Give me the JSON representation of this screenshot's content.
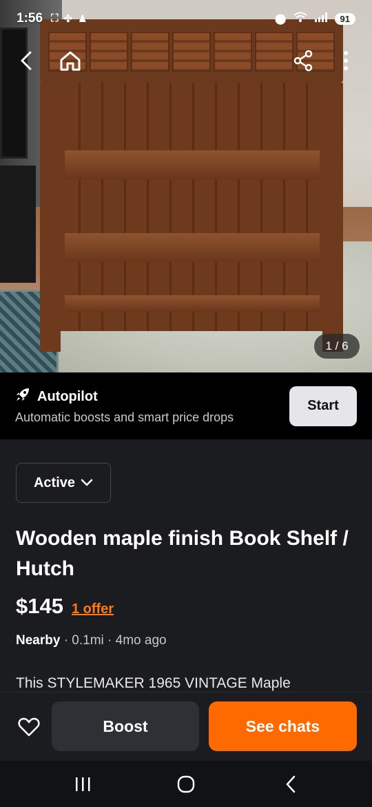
{
  "status_bar": {
    "time": "1:56",
    "battery": "91",
    "signal_label": "6"
  },
  "photo": {
    "counter": "1 / 6"
  },
  "nav": {
    "back_icon": "back-arrow-icon",
    "home_icon": "home-icon",
    "share_icon": "share-icon",
    "more_icon": "more-vertical-icon"
  },
  "autopilot": {
    "title": "Autopilot",
    "subtitle": "Automatic boosts and smart price drops",
    "start_label": "Start",
    "icon": "rocket-icon"
  },
  "listing": {
    "status": "Active",
    "title": "Wooden maple finish Book Shelf / Hutch",
    "price": "$145",
    "offer": "1 offer",
    "location": "Nearby",
    "distance": "· 0.1mi · 4mo ago",
    "description": "This STYLEMAKER 1965 VINTAGE Maple"
  },
  "actions": {
    "boost": "Boost",
    "see_chats": "See chats"
  },
  "colors": {
    "accent": "#ff6a00",
    "offer": "#ff7a1a",
    "background": "#1b1c20"
  }
}
